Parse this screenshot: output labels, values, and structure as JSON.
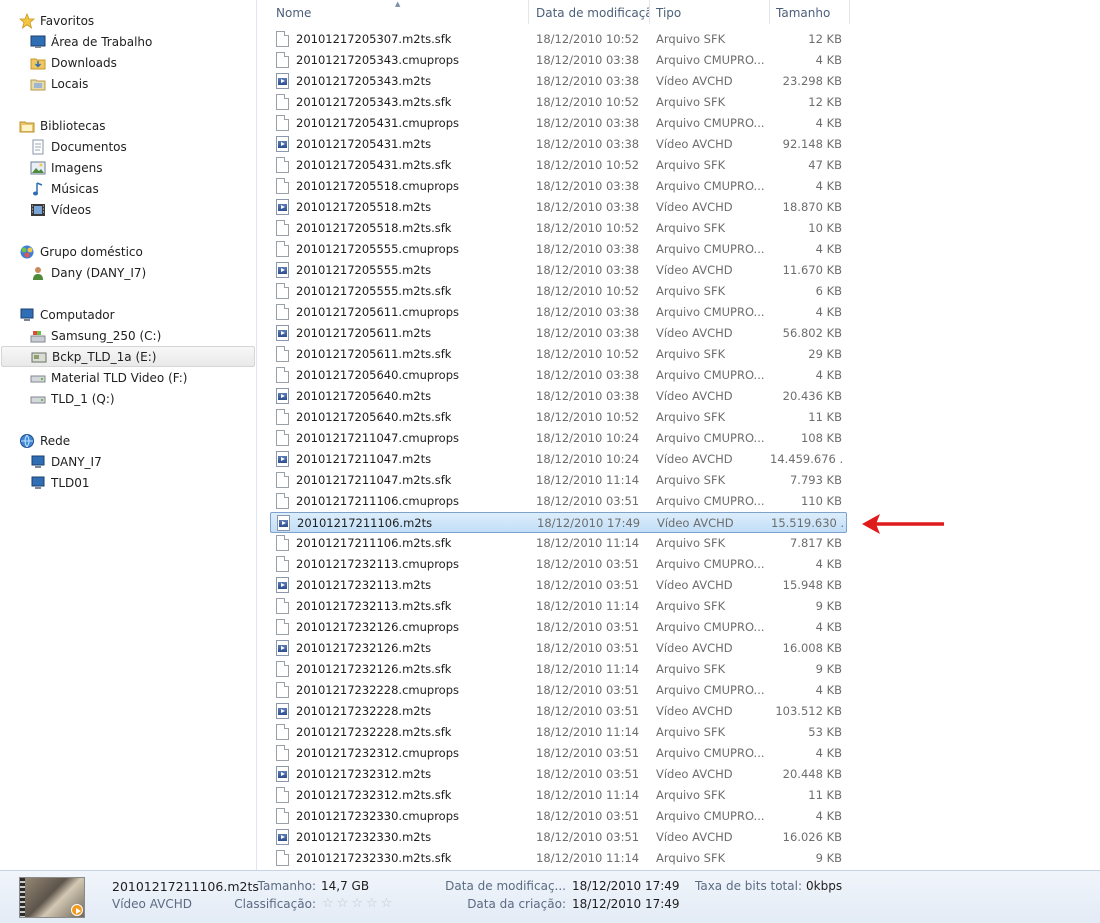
{
  "nav": {
    "favorites": {
      "label": "Favoritos",
      "items": [
        "Área de Trabalho",
        "Downloads",
        "Locais"
      ]
    },
    "libraries": {
      "label": "Bibliotecas",
      "items": [
        "Documentos",
        "Imagens",
        "Músicas",
        "Vídeos"
      ]
    },
    "homegroup": {
      "label": "Grupo doméstico",
      "items": [
        "Dany (DANY_I7)"
      ]
    },
    "computer": {
      "label": "Computador",
      "items": [
        "Samsung_250 (C:)",
        "Bckp_TLD_1a (E:)",
        "Material TLD Video (F:)",
        "TLD_1 (Q:)"
      ],
      "selected": "Bckp_TLD_1a (E:)"
    },
    "network": {
      "label": "Rede",
      "items": [
        "DANY_I7",
        "TLD01"
      ]
    }
  },
  "columns": {
    "name": "Nome",
    "date": "Data de modificaçã...",
    "type": "Tipo",
    "size": "Tamanho"
  },
  "files": [
    {
      "name": "20101217205307.m2ts.sfk",
      "date": "18/12/2010 10:52",
      "type": "Arquivo SFK",
      "size": "12 KB",
      "kind": "doc"
    },
    {
      "name": "20101217205343.cmuprops",
      "date": "18/12/2010 03:38",
      "type": "Arquivo CMUPRO...",
      "size": "4 KB",
      "kind": "doc"
    },
    {
      "name": "20101217205343.m2ts",
      "date": "18/12/2010 03:38",
      "type": "Vídeo AVCHD",
      "size": "23.298 KB",
      "kind": "video"
    },
    {
      "name": "20101217205343.m2ts.sfk",
      "date": "18/12/2010 10:52",
      "type": "Arquivo SFK",
      "size": "12 KB",
      "kind": "doc"
    },
    {
      "name": "20101217205431.cmuprops",
      "date": "18/12/2010 03:38",
      "type": "Arquivo CMUPRO...",
      "size": "4 KB",
      "kind": "doc"
    },
    {
      "name": "20101217205431.m2ts",
      "date": "18/12/2010 03:38",
      "type": "Vídeo AVCHD",
      "size": "92.148 KB",
      "kind": "video"
    },
    {
      "name": "20101217205431.m2ts.sfk",
      "date": "18/12/2010 10:52",
      "type": "Arquivo SFK",
      "size": "47 KB",
      "kind": "doc"
    },
    {
      "name": "20101217205518.cmuprops",
      "date": "18/12/2010 03:38",
      "type": "Arquivo CMUPRO...",
      "size": "4 KB",
      "kind": "doc"
    },
    {
      "name": "20101217205518.m2ts",
      "date": "18/12/2010 03:38",
      "type": "Vídeo AVCHD",
      "size": "18.870 KB",
      "kind": "video"
    },
    {
      "name": "20101217205518.m2ts.sfk",
      "date": "18/12/2010 10:52",
      "type": "Arquivo SFK",
      "size": "10 KB",
      "kind": "doc"
    },
    {
      "name": "20101217205555.cmuprops",
      "date": "18/12/2010 03:38",
      "type": "Arquivo CMUPRO...",
      "size": "4 KB",
      "kind": "doc"
    },
    {
      "name": "20101217205555.m2ts",
      "date": "18/12/2010 03:38",
      "type": "Vídeo AVCHD",
      "size": "11.670 KB",
      "kind": "video"
    },
    {
      "name": "20101217205555.m2ts.sfk",
      "date": "18/12/2010 10:52",
      "type": "Arquivo SFK",
      "size": "6 KB",
      "kind": "doc"
    },
    {
      "name": "20101217205611.cmuprops",
      "date": "18/12/2010 03:38",
      "type": "Arquivo CMUPRO...",
      "size": "4 KB",
      "kind": "doc"
    },
    {
      "name": "20101217205611.m2ts",
      "date": "18/12/2010 03:38",
      "type": "Vídeo AVCHD",
      "size": "56.802 KB",
      "kind": "video"
    },
    {
      "name": "20101217205611.m2ts.sfk",
      "date": "18/12/2010 10:52",
      "type": "Arquivo SFK",
      "size": "29 KB",
      "kind": "doc"
    },
    {
      "name": "20101217205640.cmuprops",
      "date": "18/12/2010 03:38",
      "type": "Arquivo CMUPRO...",
      "size": "4 KB",
      "kind": "doc"
    },
    {
      "name": "20101217205640.m2ts",
      "date": "18/12/2010 03:38",
      "type": "Vídeo AVCHD",
      "size": "20.436 KB",
      "kind": "video"
    },
    {
      "name": "20101217205640.m2ts.sfk",
      "date": "18/12/2010 10:52",
      "type": "Arquivo SFK",
      "size": "11 KB",
      "kind": "doc"
    },
    {
      "name": "20101217211047.cmuprops",
      "date": "18/12/2010 10:24",
      "type": "Arquivo CMUPRO...",
      "size": "108 KB",
      "kind": "doc"
    },
    {
      "name": "20101217211047.m2ts",
      "date": "18/12/2010 10:24",
      "type": "Vídeo AVCHD",
      "size": "14.459.676 ...",
      "kind": "video"
    },
    {
      "name": "20101217211047.m2ts.sfk",
      "date": "18/12/2010 11:14",
      "type": "Arquivo SFK",
      "size": "7.793 KB",
      "kind": "doc"
    },
    {
      "name": "20101217211106.cmuprops",
      "date": "18/12/2010 03:51",
      "type": "Arquivo CMUPRO...",
      "size": "110 KB",
      "kind": "doc"
    },
    {
      "name": "20101217211106.m2ts",
      "date": "18/12/2010 17:49",
      "type": "Vídeo AVCHD",
      "size": "15.519.630 ...",
      "kind": "video",
      "selected": true
    },
    {
      "name": "20101217211106.m2ts.sfk",
      "date": "18/12/2010 11:14",
      "type": "Arquivo SFK",
      "size": "7.817 KB",
      "kind": "doc"
    },
    {
      "name": "20101217232113.cmuprops",
      "date": "18/12/2010 03:51",
      "type": "Arquivo CMUPRO...",
      "size": "4 KB",
      "kind": "doc"
    },
    {
      "name": "20101217232113.m2ts",
      "date": "18/12/2010 03:51",
      "type": "Vídeo AVCHD",
      "size": "15.948 KB",
      "kind": "video"
    },
    {
      "name": "20101217232113.m2ts.sfk",
      "date": "18/12/2010 11:14",
      "type": "Arquivo SFK",
      "size": "9 KB",
      "kind": "doc"
    },
    {
      "name": "20101217232126.cmuprops",
      "date": "18/12/2010 03:51",
      "type": "Arquivo CMUPRO...",
      "size": "4 KB",
      "kind": "doc"
    },
    {
      "name": "20101217232126.m2ts",
      "date": "18/12/2010 03:51",
      "type": "Vídeo AVCHD",
      "size": "16.008 KB",
      "kind": "video"
    },
    {
      "name": "20101217232126.m2ts.sfk",
      "date": "18/12/2010 11:14",
      "type": "Arquivo SFK",
      "size": "9 KB",
      "kind": "doc"
    },
    {
      "name": "20101217232228.cmuprops",
      "date": "18/12/2010 03:51",
      "type": "Arquivo CMUPRO...",
      "size": "4 KB",
      "kind": "doc"
    },
    {
      "name": "20101217232228.m2ts",
      "date": "18/12/2010 03:51",
      "type": "Vídeo AVCHD",
      "size": "103.512 KB",
      "kind": "video"
    },
    {
      "name": "20101217232228.m2ts.sfk",
      "date": "18/12/2010 11:14",
      "type": "Arquivo SFK",
      "size": "53 KB",
      "kind": "doc"
    },
    {
      "name": "20101217232312.cmuprops",
      "date": "18/12/2010 03:51",
      "type": "Arquivo CMUPRO...",
      "size": "4 KB",
      "kind": "doc"
    },
    {
      "name": "20101217232312.m2ts",
      "date": "18/12/2010 03:51",
      "type": "Vídeo AVCHD",
      "size": "20.448 KB",
      "kind": "video"
    },
    {
      "name": "20101217232312.m2ts.sfk",
      "date": "18/12/2010 11:14",
      "type": "Arquivo SFK",
      "size": "11 KB",
      "kind": "doc"
    },
    {
      "name": "20101217232330.cmuprops",
      "date": "18/12/2010 03:51",
      "type": "Arquivo CMUPRO...",
      "size": "4 KB",
      "kind": "doc"
    },
    {
      "name": "20101217232330.m2ts",
      "date": "18/12/2010 03:51",
      "type": "Vídeo AVCHD",
      "size": "16.026 KB",
      "kind": "video"
    },
    {
      "name": "20101217232330.m2ts.sfk",
      "date": "18/12/2010 11:14",
      "type": "Arquivo SFK",
      "size": "9 KB",
      "kind": "doc"
    }
  ],
  "details": {
    "file_name": "20101217211106.m2ts",
    "file_type": "Vídeo AVCHD",
    "size_label": "Tamanho:",
    "size_value": "14,7 GB",
    "rating_label": "Classificação:",
    "rating_stars": 5,
    "modified_label": "Data de modificaç...",
    "modified_value": "18/12/2010 17:49",
    "created_label": "Data da criação:",
    "created_value": "18/12/2010 17:49",
    "bitrate_label": "Taxa de bits total:",
    "bitrate_value": "0kbps"
  },
  "colors": {
    "annotation_arrow": "#e01b1b",
    "selection_border": "#7da2ce"
  }
}
